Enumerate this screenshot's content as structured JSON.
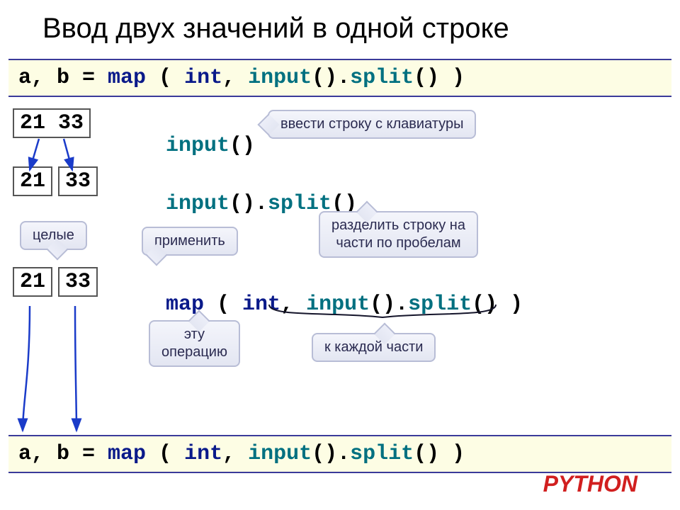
{
  "title": "Ввод двух значений в одной строке",
  "codebars": {
    "top": {
      "t1": "a, b = ",
      "t2": "map",
      "t3": " ( ",
      "t4": "int",
      "t5": ", ",
      "t6": "input",
      "t7": "().",
      "t8": "split",
      "t9": "() )"
    },
    "bottom": {
      "t1": "a, b = ",
      "t2": "map",
      "t3": " ( ",
      "t4": "int",
      "t5": ", ",
      "t6": "input",
      "t7": "().",
      "t8": "split",
      "t9": "() )"
    }
  },
  "rows": {
    "r1": {
      "box": "21 33",
      "code1": "input",
      "code2": "()"
    },
    "r2": {
      "box1": "21",
      "box2": "33",
      "code1": "input",
      "code2": "().",
      "code3": "split",
      "code4": "()"
    },
    "r3": {
      "box1": "21",
      "box2": "33",
      "code1": "map",
      "code2": " ( ",
      "code3": "int",
      "code4": ", ",
      "code5": "input",
      "code6": "().",
      "code7": "split",
      "code8": "() )"
    }
  },
  "callouts": {
    "c_input": "ввести строку с клавиатуры",
    "c_ints": "целые",
    "c_apply": "применить",
    "c_split1": "разделить строку на",
    "c_split2": "части по пробелам",
    "c_thisop1": "эту",
    "c_thisop2": "операцию",
    "c_each": "к каждой части"
  },
  "language_label": "PYTHON"
}
